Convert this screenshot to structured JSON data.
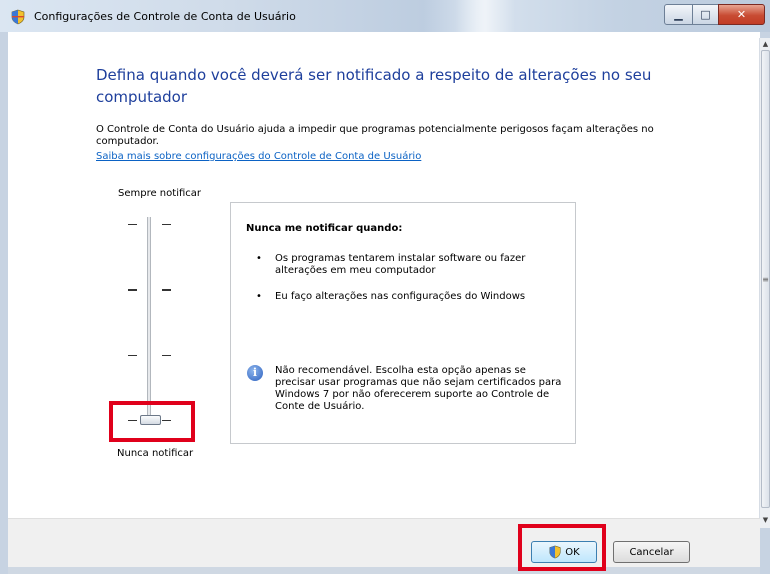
{
  "window": {
    "title": "Configurações de Controle de Conta de Usuário",
    "minimize_label": "▁",
    "maximize_label": "□",
    "close_label": "✕"
  },
  "heading": "Defina quando você deverá ser notificado a respeito de alterações no seu computador",
  "description": "O Controle de Conta do Usuário ajuda a impedir que programas potencialmente perigosos façam alterações no computador.",
  "learn_more_link": "Saiba mais sobre configurações do Controle de Conta de Usuário",
  "slider": {
    "top_label": "Sempre notificar",
    "bottom_label": "Nunca notificar",
    "levels": 4,
    "selected_level": 1
  },
  "info": {
    "heading": "Nunca me notificar quando:",
    "bullets": [
      "Os programas tentarem instalar software ou fazer alterações em meu computador",
      "Eu faço alterações nas configurações do Windows"
    ],
    "note": "Não recomendável. Escolha esta opção apenas se precisar usar programas que não sejam certificados para Windows 7 por não oferecerem suporte ao Controle de Conte de Usuário."
  },
  "buttons": {
    "ok": "OK",
    "cancel": "Cancelar"
  },
  "colors": {
    "heading": "#1e3f9c",
    "link": "#0b62c4",
    "highlight": "#e0001b"
  }
}
